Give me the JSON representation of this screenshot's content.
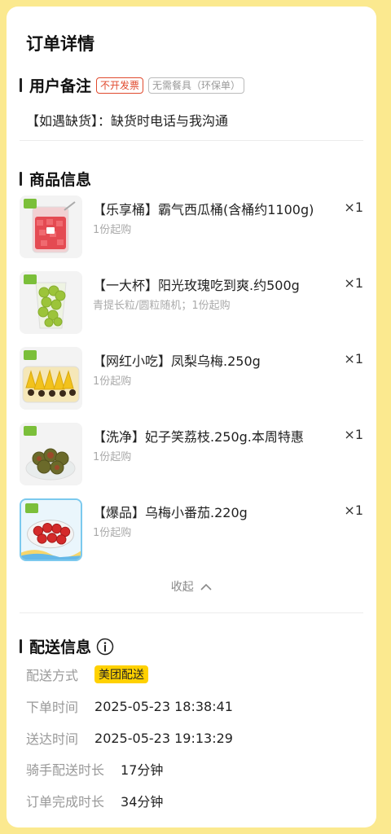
{
  "page_title": "订单详情",
  "user_note": {
    "title": "用户备注",
    "tags": [
      "不开发票",
      "无需餐具（环保单）"
    ],
    "text": "【如遇缺货】：缺货时电话与我沟通"
  },
  "goods": {
    "title": "商品信息",
    "items": [
      {
        "name": "【乐享桶】霸气西瓜桶(含桶约1100g)",
        "sub": "1份起购",
        "qty": "×1",
        "image": "watermelon-bucket"
      },
      {
        "name": "【一大杯】阳光玫瑰吃到爽.约500g",
        "sub": "青提长粒/圆粒随机；1份起购",
        "qty": "×1",
        "image": "green-grapes-cup"
      },
      {
        "name": "【网红小吃】凤梨乌梅.250g",
        "sub": "1份起购",
        "qty": "×1",
        "image": "pineapple-plum-box"
      },
      {
        "name": "【洗净】妃子笑荔枝.250g.本周特惠",
        "sub": "1份起购",
        "qty": "×1",
        "image": "lychee-box"
      },
      {
        "name": "【爆品】乌梅小番茄.220g",
        "sub": "1份起购",
        "qty": "×1",
        "image": "cherry-tomato-box"
      }
    ],
    "collapse_label": "收起"
  },
  "delivery": {
    "title": "配送信息",
    "rows": [
      {
        "key": "配送方式",
        "value": "美团配送"
      },
      {
        "key": "下单时间",
        "value": "2025-05-23 18:38:41"
      },
      {
        "key": "送达时间",
        "value": "2025-05-23 19:13:29"
      },
      {
        "key": "骑手配送时长",
        "value": "17分钟"
      },
      {
        "key": "订单完成时长",
        "value": "34分钟"
      }
    ]
  },
  "colors": {
    "background": "#fbe98f",
    "badge": "#ffd100",
    "tag_red": "#e04a2e"
  }
}
